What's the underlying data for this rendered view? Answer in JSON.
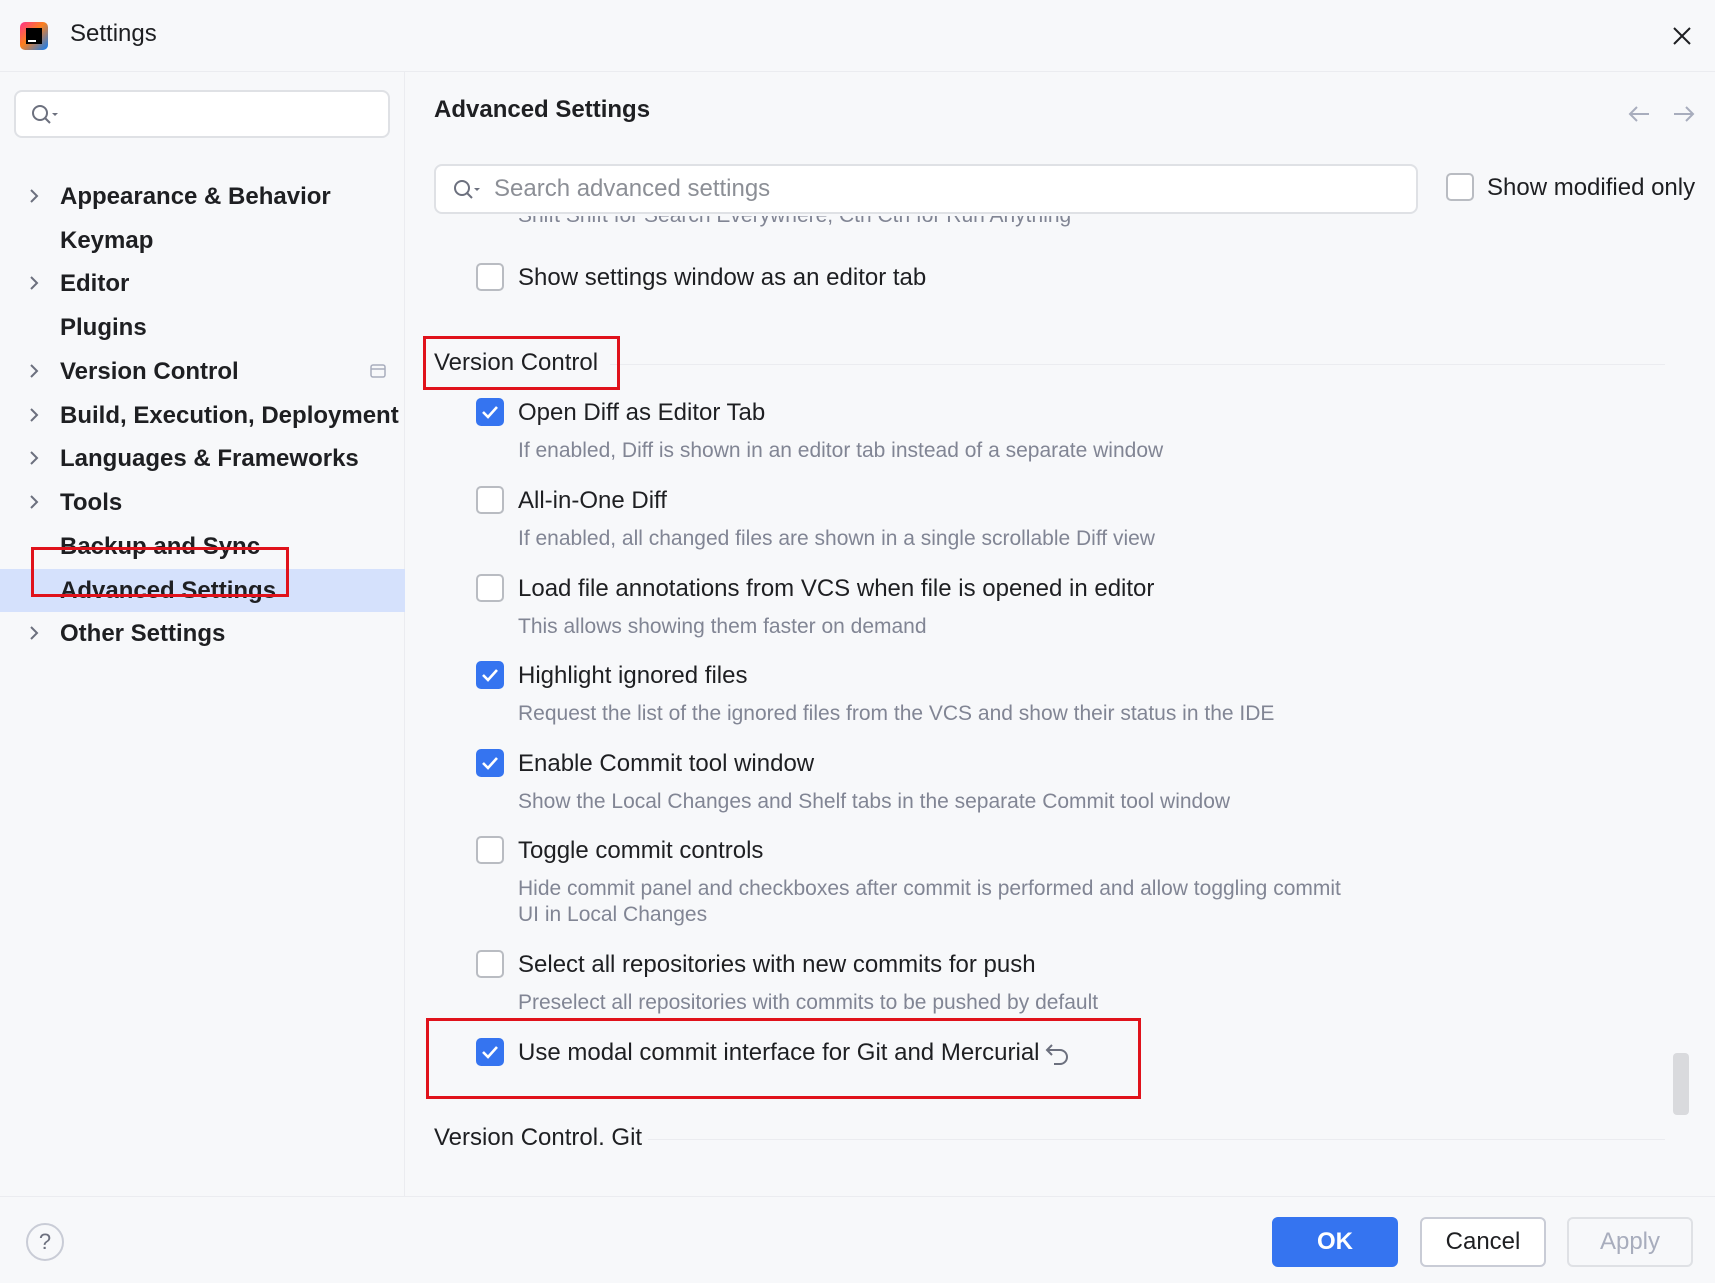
{
  "window": {
    "title": "Settings"
  },
  "sidebar": {
    "search_placeholder": "",
    "items": [
      {
        "label": "Appearance & Behavior",
        "expandable": true
      },
      {
        "label": "Keymap",
        "expandable": false
      },
      {
        "label": "Editor",
        "expandable": true
      },
      {
        "label": "Plugins",
        "expandable": false
      },
      {
        "label": "Version Control",
        "expandable": true
      },
      {
        "label": "Build, Execution, Deployment",
        "expandable": true
      },
      {
        "label": "Languages & Frameworks",
        "expandable": true
      },
      {
        "label": "Tools",
        "expandable": true
      },
      {
        "label": "Backup and Sync",
        "expandable": false
      },
      {
        "label": "Advanced Settings",
        "expandable": false,
        "selected": true
      },
      {
        "label": "Other Settings",
        "expandable": true
      }
    ]
  },
  "main": {
    "title": "Advanced Settings",
    "search_placeholder": "Search advanced settings",
    "show_modified_label": "Show modified only",
    "clipped_desc": "Shift Shift for Search Everywhere, Ctrl Ctrl for Run Anything",
    "settings_window_tab_label": "Show settings window as an editor tab",
    "section_vc": "Version Control",
    "options": [
      {
        "label": "Open Diff as Editor Tab",
        "checked": true,
        "desc": "If enabled, Diff is shown in an editor tab instead of a separate window"
      },
      {
        "label": "All-in-One Diff",
        "checked": false,
        "desc": "If enabled, all changed files are shown in a single scrollable Diff view"
      },
      {
        "label": "Load file annotations from VCS when file is opened in editor",
        "checked": false,
        "desc": "This allows showing them faster on demand"
      },
      {
        "label": "Highlight ignored files",
        "checked": true,
        "desc": "Request the list of the ignored files from the VCS and show their status in the IDE"
      },
      {
        "label": "Enable Commit tool window",
        "checked": true,
        "desc": "Show the Local Changes and Shelf tabs in the separate Commit tool window"
      },
      {
        "label": "Toggle commit controls",
        "checked": false,
        "desc": "Hide commit panel and checkboxes after commit is performed and allow toggling commit UI in Local Changes"
      },
      {
        "label": "Select all repositories with new commits for push",
        "checked": false,
        "desc": "Preselect all repositories with commits to be pushed by default"
      },
      {
        "label": "Use modal commit interface for Git and Mercurial",
        "checked": true,
        "desc": ""
      }
    ],
    "section_vc_git": "Version Control. Git"
  },
  "footer": {
    "help": "?",
    "ok": "OK",
    "cancel": "Cancel",
    "apply": "Apply"
  },
  "colors": {
    "accent": "#3574f0",
    "highlight_box": "#e0121b",
    "selection": "#d5e1fc"
  }
}
